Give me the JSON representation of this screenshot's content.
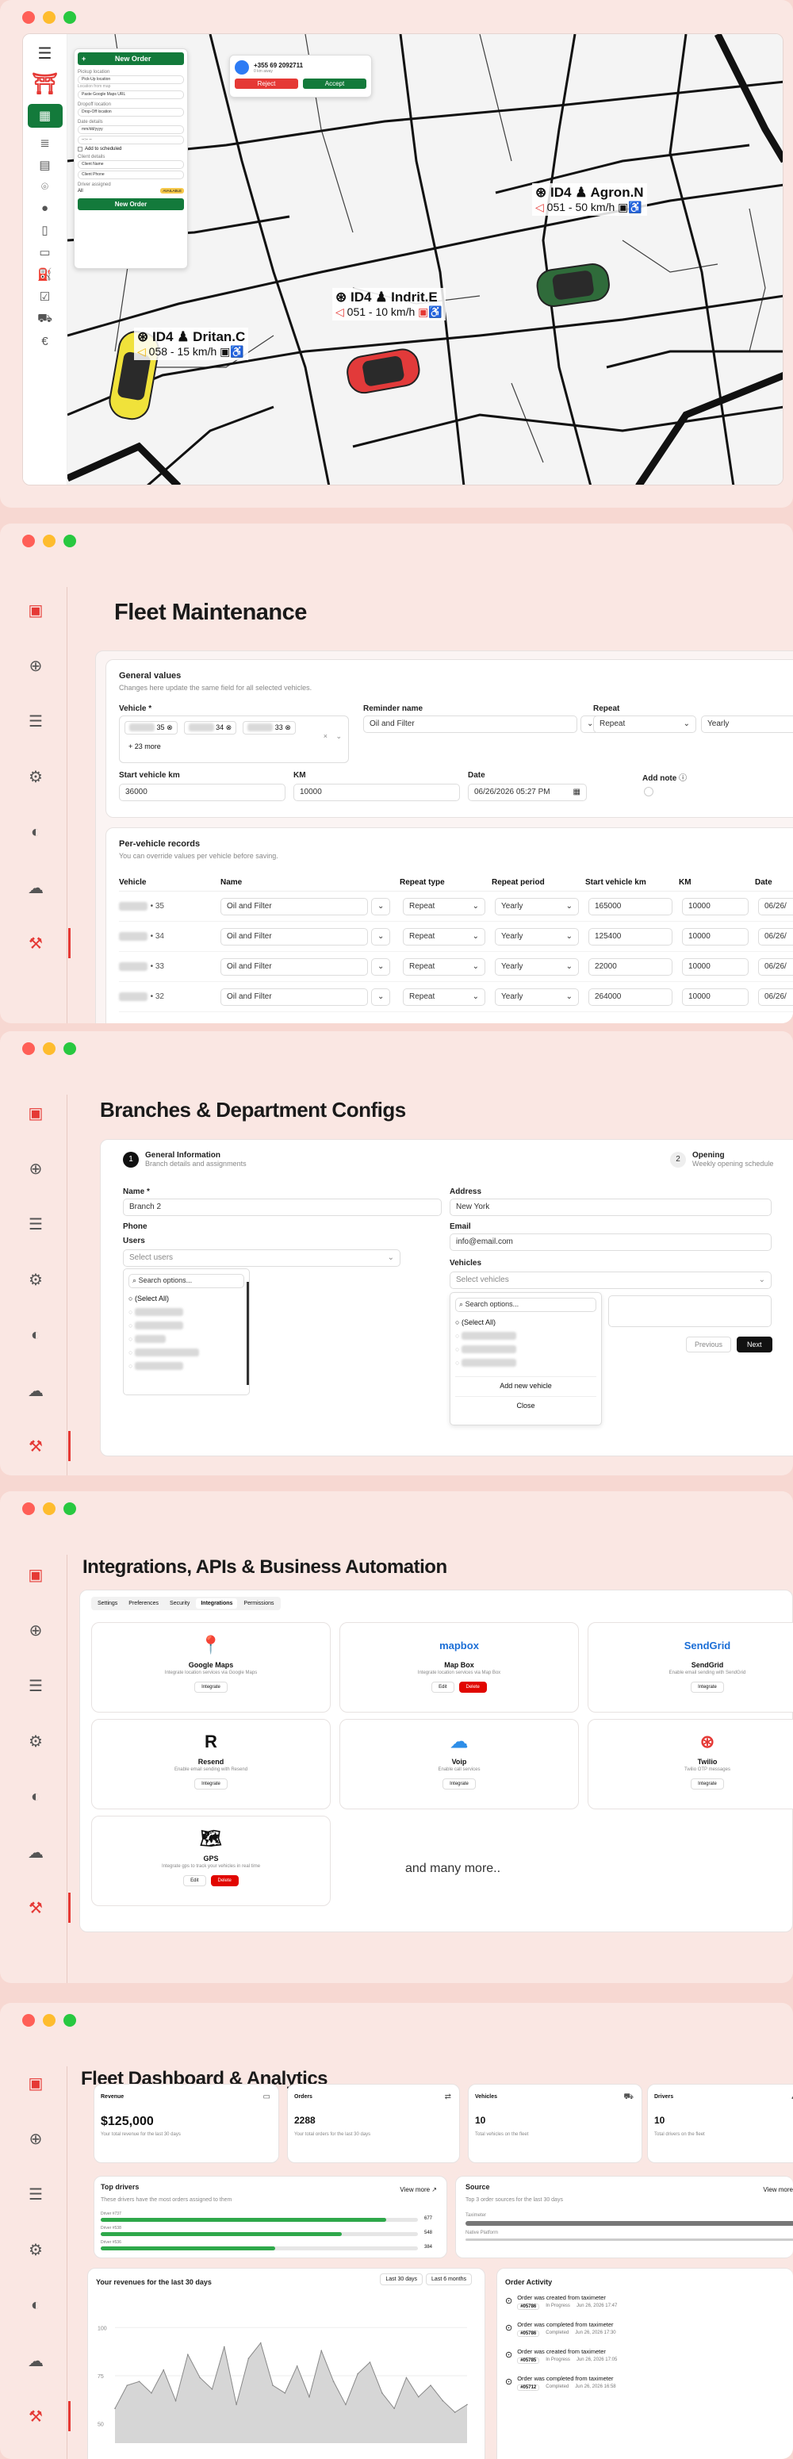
{
  "dispatch": {
    "order_form": {
      "new_order": "New Order",
      "pickup_location_label": "Pickup location",
      "pickup_location_value": "Pick-Up location",
      "location_hint": "Location from map",
      "google_maps_field": "Paste Google Maps URL",
      "dropoff_label": "Dropoff location",
      "dropoff_value": "Drop-Off location",
      "date_label": "Date details",
      "date_value": "mm/dd/yyyy",
      "time_value": "--:-- --",
      "add_to_scheduled": "Add to scheduled",
      "client_label": "Client details",
      "client_name": "Client Name",
      "client_phone": "Client Phone",
      "driver_label": "Driver assigned",
      "driver_value": "All",
      "driver_badge": "AVAILABLE",
      "submit": "New Order"
    },
    "incoming": {
      "phone": "+355 69 2092711",
      "detail": "0 km away",
      "reject": "Reject",
      "accept": "Accept"
    },
    "cars": [
      {
        "model": "ID4",
        "driver": "Agron.N",
        "speed": "051 - 50 km/h"
      },
      {
        "model": "ID4",
        "driver": "Indrit.E",
        "speed": "051 - 10 km/h"
      },
      {
        "model": "ID4",
        "driver": "Dritan.C",
        "speed": "058 - 15 km/h"
      }
    ]
  },
  "maintenance": {
    "title": "Fleet Maintenance",
    "general": {
      "heading": "General values",
      "subheading": "Changes here update the same field for all selected vehicles.",
      "vehicle_label": "Vehicle *",
      "chips": [
        "35",
        "34",
        "33"
      ],
      "more": "+ 23 more",
      "reminder_label": "Reminder name",
      "reminder_value": "Oil and Filter",
      "repeat_label": "Repeat",
      "repeat_value": "Repeat",
      "period_value": "Yearly",
      "start_km_label": "Start vehicle km",
      "start_km_value": "36000",
      "km_label": "KM",
      "km_value": "10000",
      "date_label": "Date",
      "date_value": "06/26/2026 05:27 PM",
      "note_label": "Add note"
    },
    "records": {
      "heading": "Per-vehicle records",
      "subheading": "You can override values per vehicle before saving.",
      "columns": [
        "Vehicle",
        "Name",
        "Repeat type",
        "Repeat period",
        "Start vehicle km",
        "KM",
        "Date"
      ],
      "rows": [
        {
          "vehicle": "• 35",
          "name": "Oil and Filter",
          "type": "Repeat",
          "period": "Yearly",
          "start": "165000",
          "km": "10000",
          "date": "06/26/"
        },
        {
          "vehicle": "• 34",
          "name": "Oil and Filter",
          "type": "Repeat",
          "period": "Yearly",
          "start": "125400",
          "km": "10000",
          "date": "06/26/"
        },
        {
          "vehicle": "• 33",
          "name": "Oil and Filter",
          "type": "Repeat",
          "period": "Yearly",
          "start": "22000",
          "km": "10000",
          "date": "06/26/"
        },
        {
          "vehicle": "• 32",
          "name": "Oil and Filter",
          "type": "Repeat",
          "period": "Yearly",
          "start": "264000",
          "km": "10000",
          "date": "06/26/"
        }
      ]
    }
  },
  "branches": {
    "title": "Branches & Department Configs",
    "step1_num": "1",
    "step1_title": "General Information",
    "step1_sub": "Branch details and assignments",
    "step2_num": "2",
    "step2_title": "Opening",
    "step2_sub": "Weekly opening schedule",
    "name_label": "Name *",
    "name_value": "Branch 2",
    "address_label": "Address",
    "address_value": "New York",
    "phone_label": "Phone",
    "email_label": "Email",
    "email_value": "info@email.com",
    "users_label": "Users",
    "users_placeholder": "Select users",
    "vehicles_label": "Vehicles",
    "vehicles_placeholder": "Select vehicles",
    "search_placeholder": "Search options...",
    "select_all": "(Select All)",
    "add_vehicle": "Add new vehicle",
    "close": "Close",
    "previous": "Previous",
    "next": "Next"
  },
  "integrations": {
    "title": "Integrations, APIs & Business Automation",
    "tabs": [
      "Settings",
      "Preferences",
      "Security",
      "Integrations",
      "Permissions"
    ],
    "cards": [
      {
        "name": "Google Maps",
        "desc": "Integrate location services via Google Maps",
        "icon": "google-maps-icon",
        "action": "Integrate"
      },
      {
        "name": "Map Box",
        "desc": "Integrate location services via Map Box",
        "icon": "mapbox-logo",
        "logo": "mapbox",
        "edit": "Edit",
        "delete": "Delete"
      },
      {
        "name": "SendGrid",
        "desc": "Enable email sending with SendGrid",
        "icon": "sendgrid-logo",
        "logo": "SendGrid",
        "action": "Integrate"
      },
      {
        "name": "Resend",
        "desc": "Enable email sending with Resend",
        "icon": "resend-logo",
        "action": "Integrate"
      },
      {
        "name": "Voip",
        "desc": "Enable call services",
        "icon": "voip-cloud-icon",
        "action": "Integrate"
      },
      {
        "name": "Twilio",
        "desc": "Twilio OTP messages",
        "icon": "twilio-logo",
        "action": "Integrate"
      },
      {
        "name": "GPS",
        "desc": "Integrate gps to track your vehicles in real time",
        "icon": "gps-map-icon",
        "edit": "Edit",
        "delete": "Delete"
      }
    ],
    "more_text": "and many more.."
  },
  "dashboard": {
    "title": "Fleet Dashboard & Analytics",
    "stats": [
      {
        "label": "Revenue",
        "value": "$125,000",
        "sub": "Your total revenue for the last 30 days"
      },
      {
        "label": "Orders",
        "value": "2288",
        "sub": "Your total orders for the last 30 days"
      },
      {
        "label": "Vehicles",
        "value": "10",
        "sub": "Total vehicles on the fleet"
      },
      {
        "label": "Drivers",
        "value": "10",
        "sub": "Total drivers on the fleet"
      }
    ],
    "top_drivers": {
      "title": "Top drivers",
      "sub": "These drivers have the most orders assigned to them",
      "view_more": "View more",
      "drivers": [
        {
          "name": "Driver #737",
          "value": "677",
          "pct": 0.9
        },
        {
          "name": "Driver #538",
          "value": "548",
          "pct": 0.76
        },
        {
          "name": "Driver #536",
          "value": "384",
          "pct": 0.55
        }
      ]
    },
    "source": {
      "title": "Source",
      "sub": "Top 3 order sources for the last 30 days",
      "view_more": "View more",
      "items": [
        "Taximeter",
        "Native Platform"
      ]
    },
    "revenue_chart": {
      "title": "Your revenues for the last 30 days",
      "btn_30": "Last 30 days",
      "btn_6m": "Last 6 months"
    },
    "activity": {
      "title": "Order Activity",
      "items": [
        {
          "text": "Order was created from taximeter",
          "id": "#05786",
          "status": "In Progress",
          "date": "Jun 26, 2026 17:47"
        },
        {
          "text": "Order was completed from taximeter",
          "id": "#05786",
          "status": "Completed",
          "date": "Jun 26, 2026 17:30"
        },
        {
          "text": "Order was created from taximeter",
          "id": "#05785",
          "status": "In Progress",
          "date": "Jun 26, 2026 17:05"
        },
        {
          "text": "Order was completed from taximeter",
          "id": "#05712",
          "status": "Completed",
          "date": "Jun 26, 2026 16:58"
        }
      ]
    }
  },
  "chart_data": {
    "type": "area",
    "title": "Your revenues for the last 30 days",
    "ytick_labels": [
      "100",
      "75",
      "50"
    ],
    "ylim": [
      40,
      110
    ],
    "values": [
      58,
      70,
      72,
      66,
      78,
      62,
      86,
      74,
      68,
      90,
      60,
      84,
      92,
      70,
      66,
      80,
      64,
      88,
      72,
      60,
      76,
      82,
      66,
      58,
      74,
      64,
      70,
      62,
      56,
      60
    ],
    "grid": true
  }
}
